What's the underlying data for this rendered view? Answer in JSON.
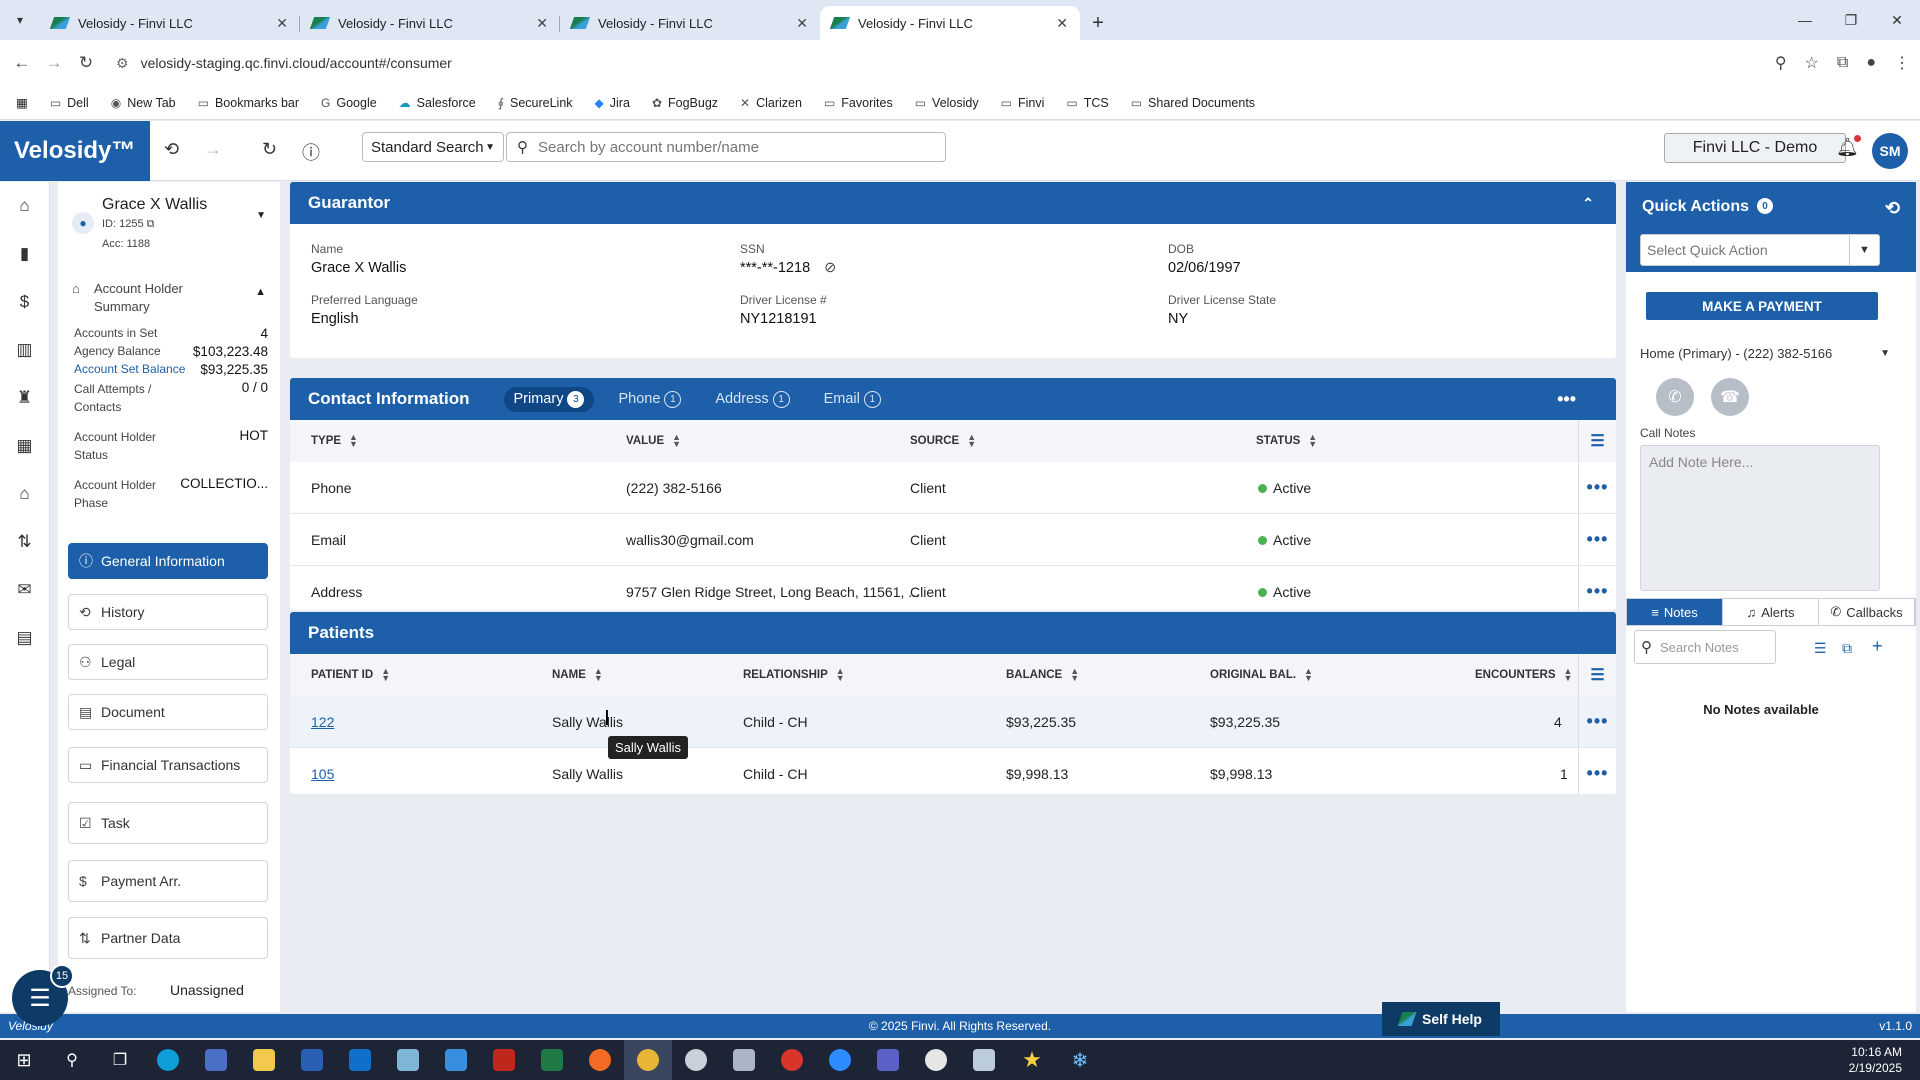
{
  "browser": {
    "tabs": [
      {
        "title": "Velosidy - Finvi LLC"
      },
      {
        "title": "Velosidy - Finvi LLC"
      },
      {
        "title": "Velosidy - Finvi LLC"
      },
      {
        "title": "Velosidy - Finvi LLC"
      }
    ],
    "url": "velosidy-staging.qc.finvi.cloud/account#/consumer",
    "bookmarks": [
      "Dell",
      "New Tab",
      "Bookmarks bar",
      "Google",
      "Salesforce",
      "SecureLink",
      "Jira",
      "FogBugz",
      "Clarizen",
      "Favorites",
      "Velosidy",
      "Finvi",
      "TCS",
      "Shared Documents"
    ]
  },
  "header": {
    "logo": "Velosidy™",
    "search_type": "Standard Search",
    "search_placeholder": "Search by account number/name",
    "org": "Finvi LLC - Demo",
    "avatar": "SM"
  },
  "account": {
    "name": "Grace X Wallis",
    "id": "ID: 1255",
    "acc": "Acc: 1188",
    "summary_title": "Account Holder Summary",
    "accounts_in_set_label": "Accounts in Set",
    "accounts_in_set": "4",
    "agency_balance_label": "Agency Balance",
    "agency_balance": "$103,223.48",
    "account_set_balance_label": "Account Set Balance",
    "account_set_balance": "$93,225.35",
    "call_attempts_label": "Call Attempts / Contacts",
    "call_attempts": "0 / 0",
    "status_label": "Account Holder Status",
    "status": "HOT",
    "phase_label": "Account Holder Phase",
    "phase": "COLLECTIO...",
    "nav": [
      "General Information",
      "History",
      "Legal",
      "Document",
      "Financial Transactions",
      "Task",
      "Payment Arr.",
      "Partner Data"
    ],
    "assigned_label": "Assigned To:",
    "assigned": "Unassigned",
    "fab_count": "15"
  },
  "guarantor": {
    "title": "Guarantor",
    "name_label": "Name",
    "name": "Grace X Wallis",
    "ssn_label": "SSN",
    "ssn": "***-**-1218",
    "dob_label": "DOB",
    "dob": "02/06/1997",
    "lang_label": "Preferred Language",
    "lang": "English",
    "dl_label": "Driver License #",
    "dl": "NY1218191",
    "dls_label": "Driver License State",
    "dls": "NY"
  },
  "contact": {
    "title": "Contact Information",
    "tabs": [
      {
        "label": "Primary",
        "count": "3"
      },
      {
        "label": "Phone",
        "count": "1"
      },
      {
        "label": "Address",
        "count": "1"
      },
      {
        "label": "Email",
        "count": "1"
      }
    ],
    "headers": [
      "TYPE",
      "VALUE",
      "SOURCE",
      "STATUS"
    ],
    "rows": [
      {
        "type": "Phone",
        "value": "(222) 382-5166",
        "source": "Client",
        "status": "Active"
      },
      {
        "type": "Email",
        "value": "wallis30@gmail.com",
        "source": "Client",
        "status": "Active"
      },
      {
        "type": "Address",
        "value": "9757 Glen Ridge Street, Long Beach, 11561, ...",
        "source": "Client",
        "status": "Active"
      }
    ]
  },
  "patients": {
    "title": "Patients",
    "headers": [
      "PATIENT ID",
      "NAME",
      "RELATIONSHIP",
      "BALANCE",
      "ORIGINAL BAL.",
      "ENCOUNTERS"
    ],
    "rows": [
      {
        "id": "122",
        "name": "Sally Wallis",
        "rel": "Child - CH",
        "balance": "$93,225.35",
        "orig": "$93,225.35",
        "enc": "4"
      },
      {
        "id": "105",
        "name": "Sally Wallis",
        "rel": "Child - CH",
        "balance": "$9,998.13",
        "orig": "$9,998.13",
        "enc": "1"
      }
    ],
    "tooltip": "Sally Wallis"
  },
  "quick": {
    "title": "Quick Actions",
    "count": "0",
    "select_placeholder": "Select Quick Action",
    "pay": "MAKE A PAYMENT",
    "phone": "Home (Primary) - (222) 382-5166",
    "notes_label": "Call Notes",
    "notes_placeholder": "Add Note Here...",
    "tabs": [
      "Notes",
      "Alerts",
      "Callbacks"
    ],
    "search_placeholder": "Search Notes",
    "empty": "No Notes available"
  },
  "footer": {
    "app": "Velosidy",
    "copyright": "© 2025 Finvi. All Rights Reserved.",
    "version": "v1.1.0",
    "self_help": "Self Help"
  },
  "taskbar": {
    "time": "10:16 AM",
    "date": "2/19/2025"
  }
}
